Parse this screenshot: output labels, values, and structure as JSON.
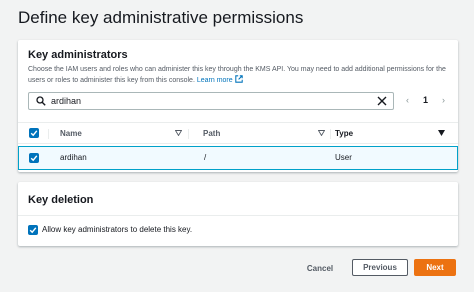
{
  "page": {
    "title": "Define key administrative permissions"
  },
  "admins": {
    "title": "Key administrators",
    "description": "Choose the IAM users and roles who can administer this key through the KMS API. You may need to add additional permissions for the users or roles to administer this key from this console.",
    "learn_more": "Learn more",
    "search_value": "ardihan",
    "pager": {
      "prev": "‹",
      "page": "1",
      "next": "›"
    },
    "columns": {
      "name": "Name",
      "path": "Path",
      "type": "Type"
    },
    "rows": [
      {
        "name": "ardihan",
        "path": "/",
        "type": "User",
        "checked": true
      }
    ]
  },
  "deletion": {
    "title": "Key deletion",
    "checkbox_label": "Allow key administrators to delete this key."
  },
  "footer": {
    "cancel": "Cancel",
    "previous": "Previous",
    "next": "Next"
  },
  "colors": {
    "primary": "#ec7211",
    "link": "#0073bb",
    "selected_row_border": "#00a1c9",
    "selected_row_bg": "#f1faff"
  },
  "icons": {
    "search": "search-icon",
    "clear": "clear-icon",
    "external_link": "external-link-icon",
    "sort": "sort-caret-icon",
    "checkbox": "checkmark-icon"
  }
}
